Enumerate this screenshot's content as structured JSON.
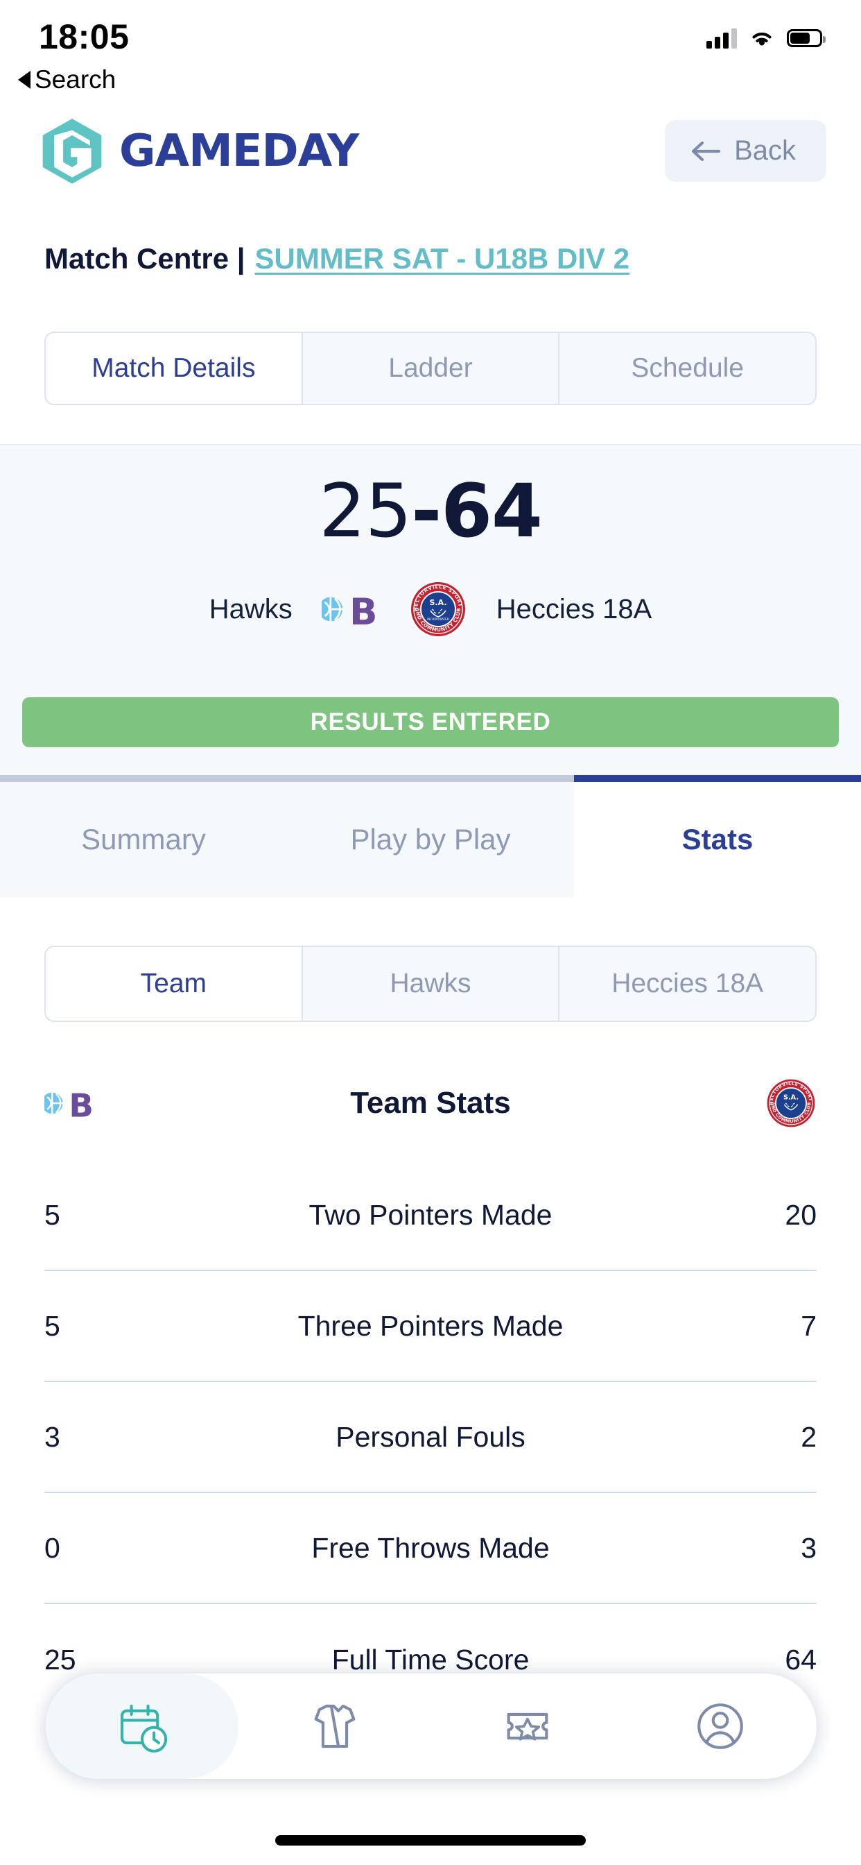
{
  "status_bar": {
    "time": "18:05",
    "return_label": "Search",
    "icons": [
      "cellular-signal-icon",
      "wifi-icon",
      "battery-icon"
    ]
  },
  "header": {
    "brand": "GAMEDAY",
    "brand_mark": "gameday-hex-g-logo",
    "back_label": "Back",
    "back_icon": "arrow-left-icon"
  },
  "breadcrumb": {
    "prefix": "Match Centre |",
    "competition": "SUMMER SAT - U18B DIV 2"
  },
  "primary_tabs": [
    {
      "label": "Match Details",
      "active": true
    },
    {
      "label": "Ladder",
      "active": false
    },
    {
      "label": "Schedule",
      "active": false
    }
  ],
  "scoreboard": {
    "home_score": "25",
    "separator": "-",
    "away_score": "64",
    "home_team": "Hawks",
    "away_team": "Heccies 18A",
    "home_crest": "hawks-basketball-b-crest",
    "away_crest": "hectorville-sports-community-club-crest",
    "status_banner": "RESULTS ENTERED",
    "status_color": "#7ec480"
  },
  "segment_tabs": [
    {
      "label": "Summary",
      "active": false
    },
    {
      "label": "Play by Play",
      "active": false
    },
    {
      "label": "Stats",
      "active": true
    }
  ],
  "stats_tabs": [
    {
      "label": "Team",
      "active": true
    },
    {
      "label": "Hawks",
      "active": false
    },
    {
      "label": "Heccies 18A",
      "active": false
    }
  ],
  "team_stats": {
    "title": "Team Stats",
    "home_crest": "hawks-basketball-b-crest",
    "away_crest": "hectorville-sports-community-club-crest",
    "rows": [
      {
        "home": "5",
        "label": "Two Pointers Made",
        "away": "20"
      },
      {
        "home": "5",
        "label": "Three Pointers Made",
        "away": "7"
      },
      {
        "home": "3",
        "label": "Personal Fouls",
        "away": "2"
      },
      {
        "home": "0",
        "label": "Free Throws Made",
        "away": "3"
      },
      {
        "home": "25",
        "label": "Full Time Score",
        "away": "64"
      }
    ]
  },
  "bottom_nav": [
    {
      "icon": "calendar-clock-icon",
      "active": true
    },
    {
      "icon": "jersey-icon",
      "active": false
    },
    {
      "icon": "ticket-star-icon",
      "active": false
    },
    {
      "icon": "account-circle-icon",
      "active": false
    }
  ],
  "colors": {
    "brand_blue": "#2b3f98",
    "brand_teal": "#62bdc9",
    "accent_green": "#7ec480",
    "text_dark": "#0f1836",
    "text_muted": "#8e9ab5"
  }
}
